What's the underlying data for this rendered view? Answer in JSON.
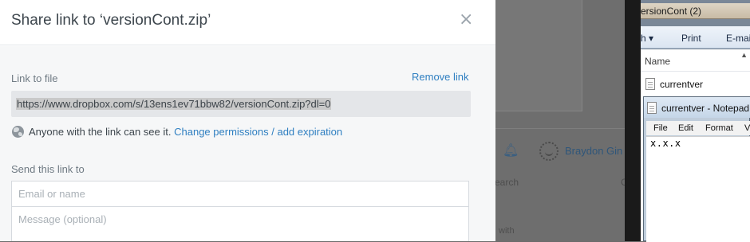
{
  "dialog": {
    "title": "Share link to ‘versionCont.zip’",
    "close_icon": "close-icon",
    "link_label": "Link to file",
    "remove_link": "Remove link",
    "url": "https://www.dropbox.com/s/13ens1ev71bbw82/versionCont.zip?dl=0",
    "visibility_text": "Anyone with the link can see it.",
    "visibility_icon": "globe-icon",
    "change_permissions": "Change permissions / add expiration",
    "send_label": "Send this link to",
    "email_placeholder": "Email or name",
    "message_placeholder": "Message (optional)"
  },
  "background": {
    "user_name": "Braydon Gin",
    "search_text": "earch",
    "search_trailing": "C",
    "with_text": "with"
  },
  "explorer": {
    "title": "ersionCont (2)",
    "toolbar_partial": "h ▾",
    "toolbar_print": "Print",
    "toolbar_email": "E-mai",
    "column_header": "Name",
    "file": "currentver"
  },
  "notepad": {
    "title": "currentver - Notepad",
    "menu": [
      "File",
      "Edit",
      "Format",
      "V"
    ],
    "content": "x.x.x"
  },
  "colors": {
    "link_blue": "#2f7fc1",
    "dialog_bg": "#ffffff",
    "body_bg": "#f6f7f8",
    "overlay": "#6e6e6e"
  }
}
